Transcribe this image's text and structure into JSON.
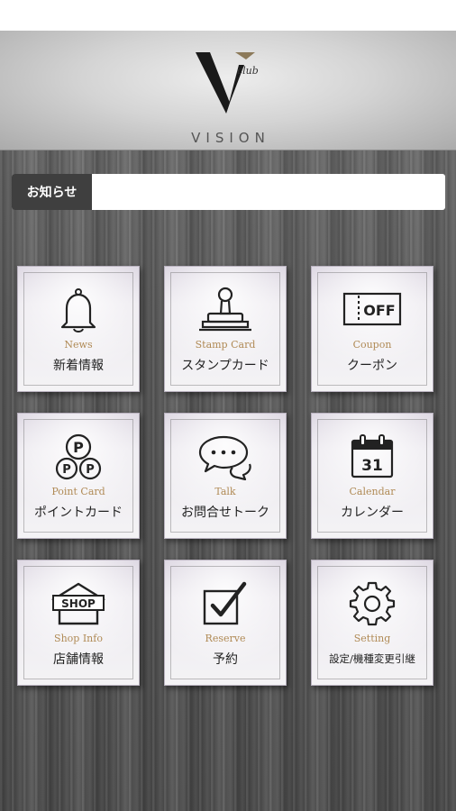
{
  "brand": {
    "name": "VISION",
    "sub": "club",
    "mark": "V"
  },
  "news": {
    "label": "お知らせ",
    "content": ""
  },
  "colors": {
    "en_label": "#b08a55",
    "tile_text": "#222222",
    "news_label_bg": "#3f3f3f"
  },
  "menu": [
    {
      "en": "News",
      "jp": "新着情報",
      "icon": "bell-icon"
    },
    {
      "en": "Stamp Card",
      "jp": "スタンプカード",
      "icon": "stamp-icon"
    },
    {
      "en": "Coupon",
      "jp": "クーポン",
      "icon": "coupon-icon",
      "icon_text": "OFF"
    },
    {
      "en": "Point Card",
      "jp": "ポイントカード",
      "icon": "point-card-icon",
      "icon_text": "P"
    },
    {
      "en": "Talk",
      "jp": "お問合せトーク",
      "icon": "chat-bubbles-icon"
    },
    {
      "en": "Calendar",
      "jp": "カレンダー",
      "icon": "calendar-icon",
      "icon_text": "31"
    },
    {
      "en": "Shop Info",
      "jp": "店舗情報",
      "icon": "shop-icon",
      "icon_text": "SHOP"
    },
    {
      "en": "Reserve",
      "jp": "予約",
      "icon": "checkbox-icon"
    },
    {
      "en": "Setting",
      "jp": "設定/機種変更引継",
      "icon": "gear-icon"
    }
  ]
}
